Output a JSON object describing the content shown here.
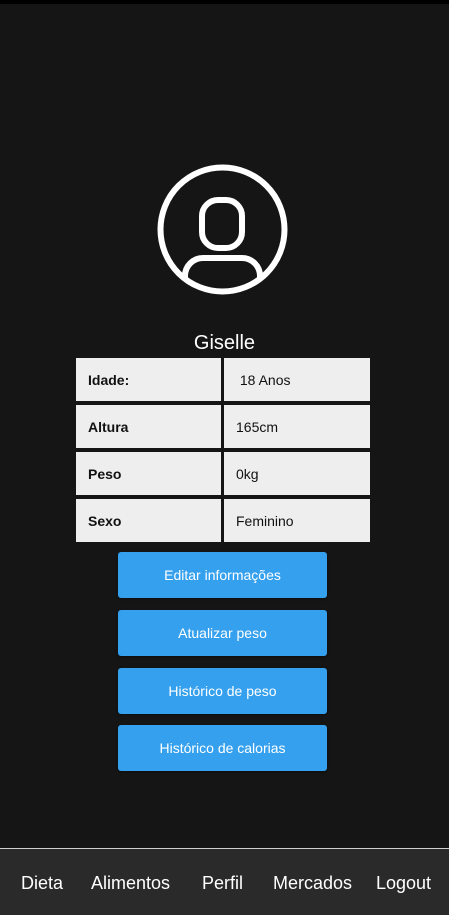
{
  "profile": {
    "avatar_icon": "user-avatar-icon",
    "name": "Giselle"
  },
  "info": {
    "rows": [
      {
        "label": "Idade:",
        "value": " 18 Anos"
      },
      {
        "label": "Altura",
        "value": "165cm"
      },
      {
        "label": "Peso",
        "value": "0kg"
      },
      {
        "label": "Sexo",
        "value": "Feminino"
      }
    ]
  },
  "actions": {
    "edit_info": "Editar informações",
    "update_weight": "Atualizar peso",
    "weight_history": "Histórico de peso",
    "calorie_history": "Histórico de calorias"
  },
  "nav": {
    "items": [
      "Dieta",
      "Alimentos",
      "Perfil",
      "Mercados",
      "Logout"
    ]
  },
  "colors": {
    "background": "#151515",
    "button": "#35a0ee",
    "cell": "#eeeeee",
    "nav_bar": "#2a2a2a"
  }
}
